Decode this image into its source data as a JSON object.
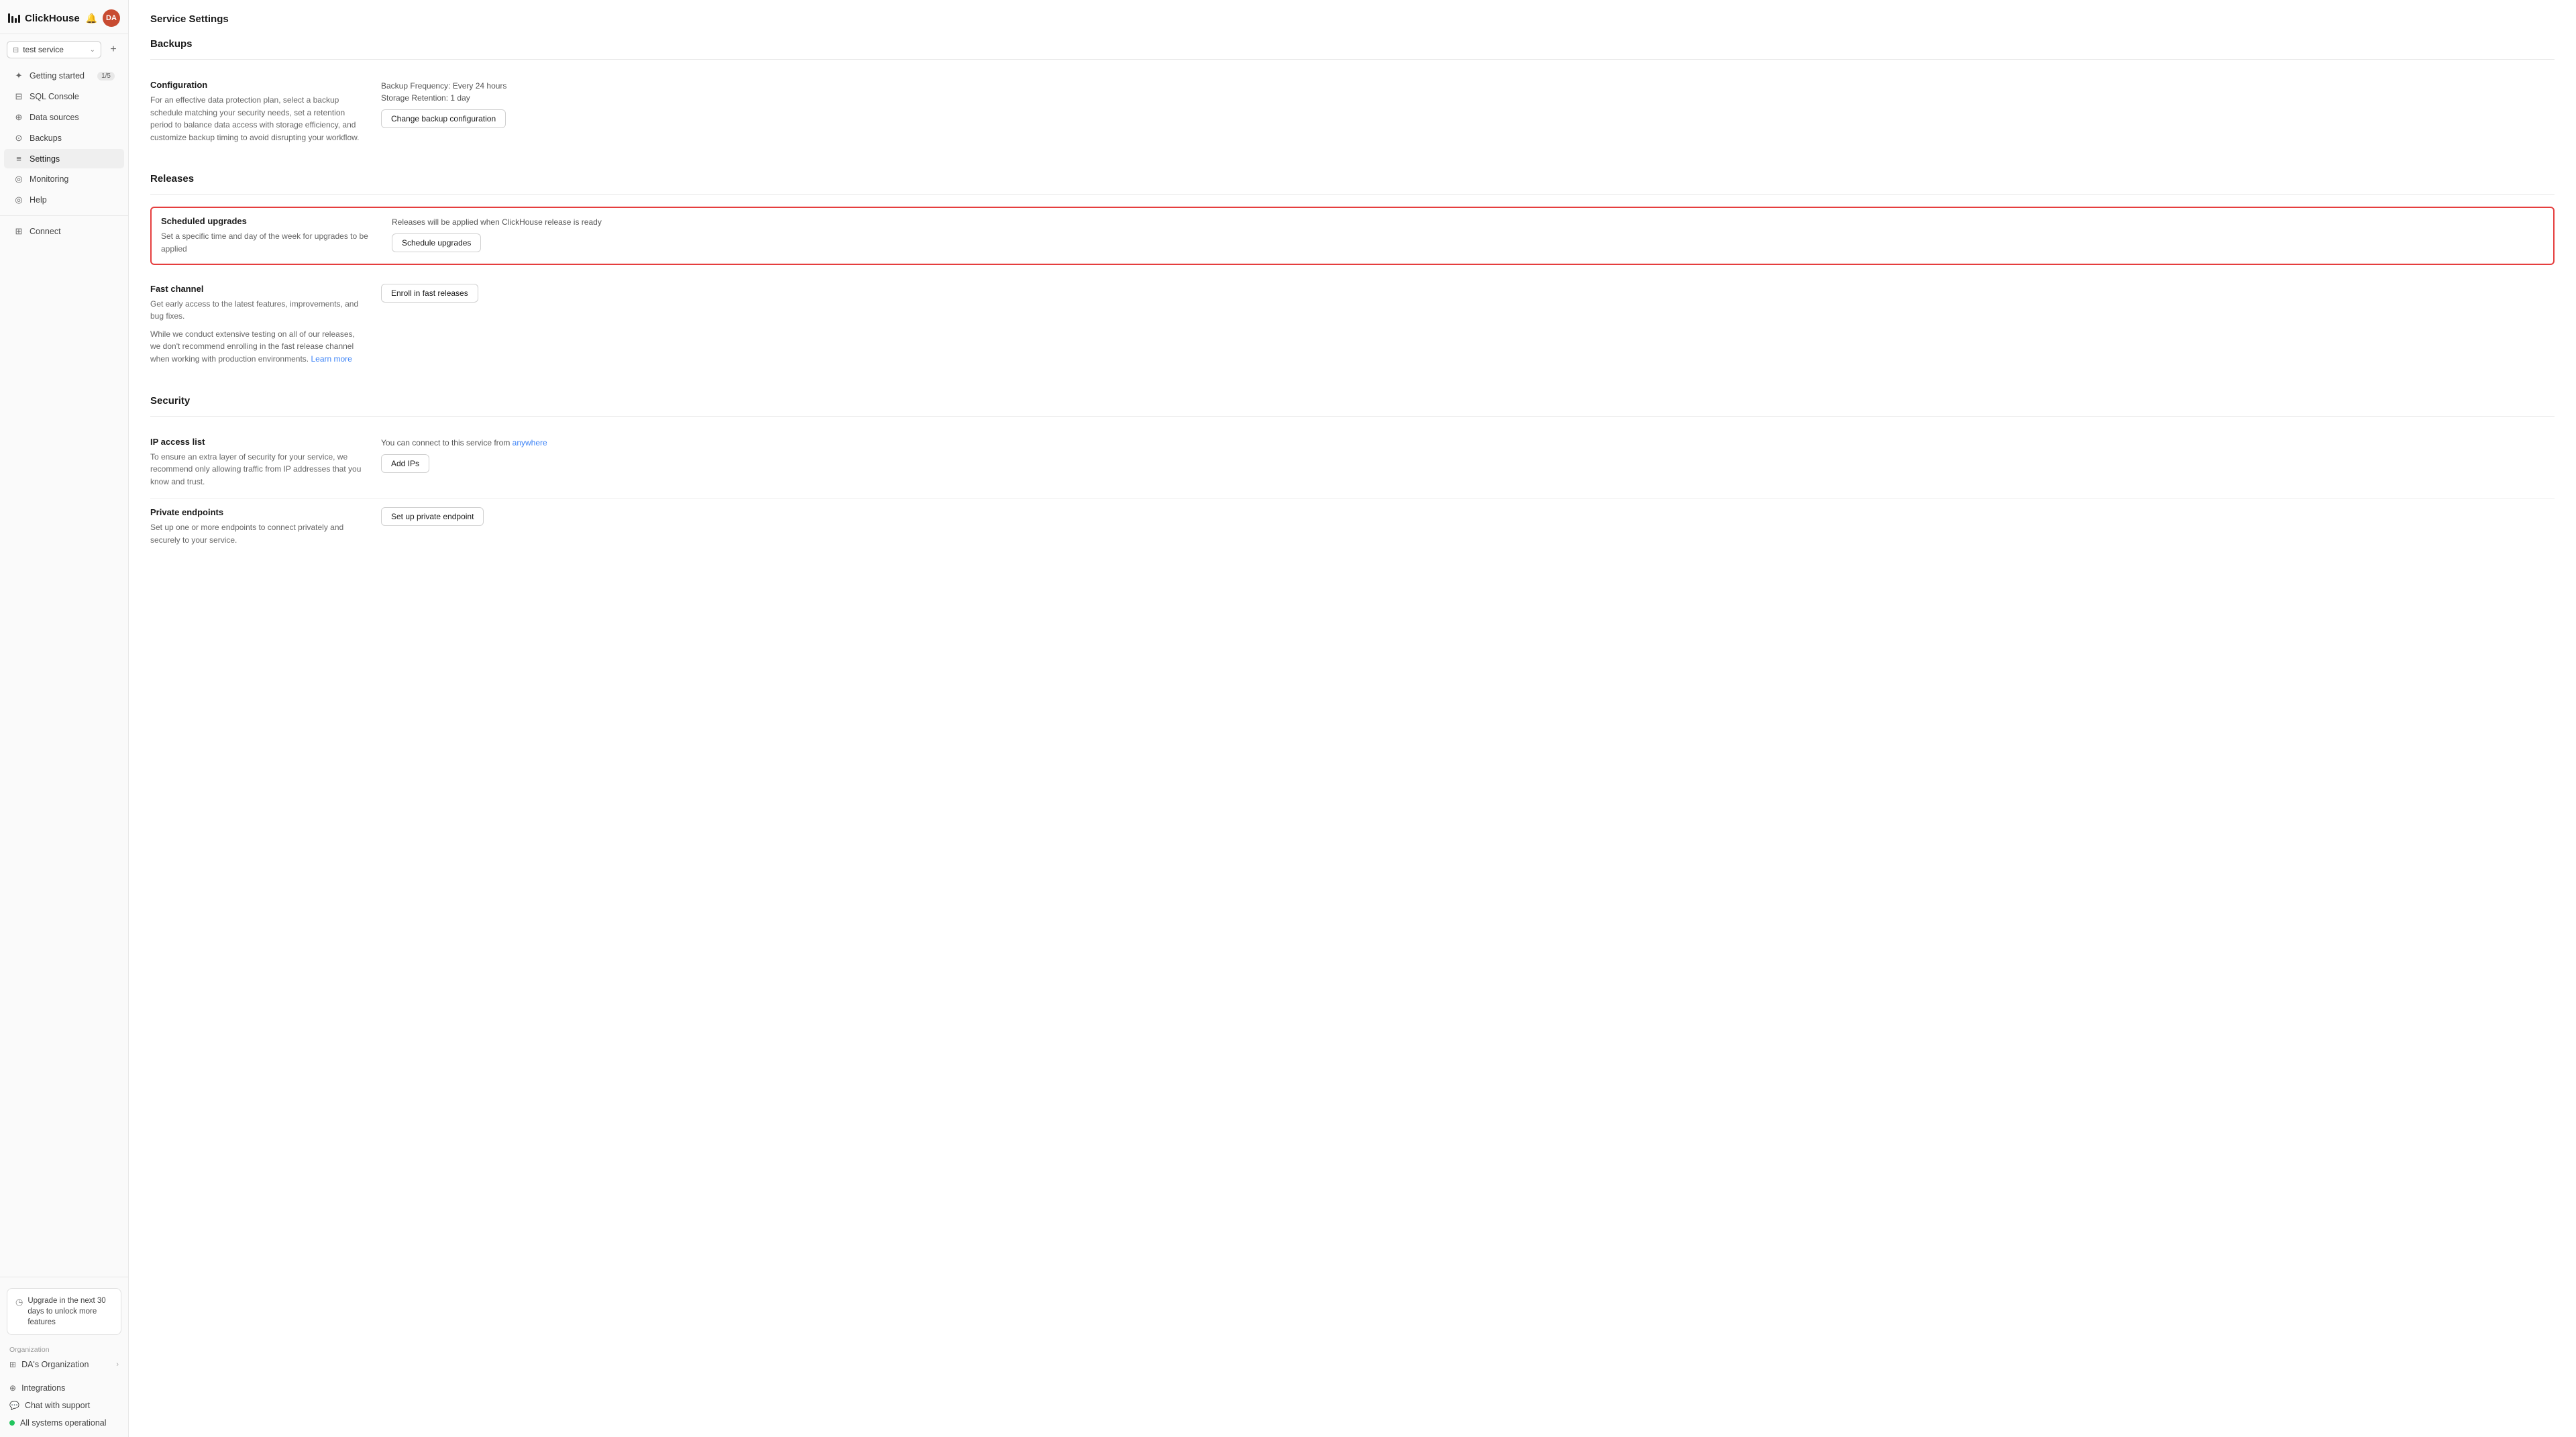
{
  "app": {
    "name": "ClickHouse"
  },
  "header": {
    "avatar": "DA",
    "page_title": "Service Settings"
  },
  "service_selector": {
    "name": "test service",
    "placeholder": "test service"
  },
  "sidebar": {
    "nav_items": [
      {
        "id": "getting-started",
        "label": "Getting started",
        "icon": "✦",
        "badge": "1/5"
      },
      {
        "id": "sql-console",
        "label": "SQL Console",
        "icon": "⊟"
      },
      {
        "id": "data-sources",
        "label": "Data sources",
        "icon": "⊕"
      },
      {
        "id": "backups",
        "label": "Backups",
        "icon": "⊙"
      },
      {
        "id": "settings",
        "label": "Settings",
        "icon": "≡",
        "active": true
      },
      {
        "id": "monitoring",
        "label": "Monitoring",
        "icon": "◎"
      },
      {
        "id": "help",
        "label": "Help",
        "icon": "◎"
      }
    ],
    "connect_item": {
      "label": "Connect",
      "icon": "⊞"
    },
    "upgrade": {
      "text": "Upgrade in the next 30 days to unlock more features"
    },
    "org_section": {
      "label": "Organization",
      "name": "DA's Organization"
    },
    "bottom_links": [
      {
        "id": "integrations",
        "label": "Integrations",
        "icon": "⊕"
      },
      {
        "id": "chat-support",
        "label": "Chat with support",
        "icon": "💬"
      },
      {
        "id": "all-systems",
        "label": "All systems operational",
        "icon": "dot"
      }
    ]
  },
  "backups": {
    "section_title": "Backups",
    "configuration": {
      "label": "Configuration",
      "desc": "For an effective data protection plan, select a backup schedule matching your security needs, set a retention period to balance data access with storage efficiency, and customize backup timing to avoid disrupting your workflow.",
      "info_line1": "Backup Frequency: Every 24 hours",
      "info_line2": "Storage Retention: 1 day",
      "button": "Change backup configuration"
    }
  },
  "releases": {
    "section_title": "Releases",
    "scheduled_upgrades": {
      "label": "Scheduled upgrades",
      "desc": "Set a specific time and day of the week for upgrades to be applied",
      "status": "Releases will be applied when ClickHouse release is ready",
      "button": "Schedule upgrades"
    },
    "fast_channel": {
      "label": "Fast channel",
      "desc1": "Get early access to the latest features, improvements, and bug fixes.",
      "desc2": "While we conduct extensive testing on all of our releases, we don't recommend enrolling in the fast release channel when working with production environments.",
      "learn_more": "Learn more",
      "button": "Enroll in fast releases"
    }
  },
  "security": {
    "section_title": "Security",
    "ip_access": {
      "label": "IP access list",
      "desc": "To ensure an extra layer of security for your service, we recommend only allowing traffic from IP addresses that you know and trust.",
      "info_prefix": "You can connect to this service from ",
      "info_link": "anywhere",
      "button": "Add IPs"
    },
    "private_endpoints": {
      "label": "Private endpoints",
      "desc": "Set up one or more endpoints to connect privately and securely to your service.",
      "button": "Set up private endpoint"
    }
  }
}
